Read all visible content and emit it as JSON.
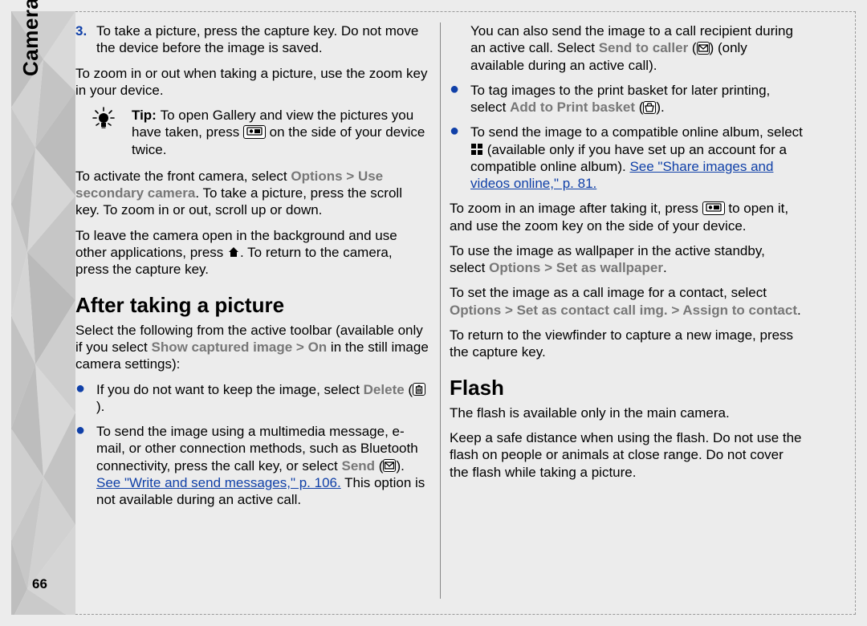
{
  "sidebar_label": "Camera",
  "page_number": "66",
  "left": {
    "num3": {
      "n": "3.",
      "text": "To take a picture, press the capture key. Do not move the device before the image is saved."
    },
    "p_zoom": "To zoom in or out when taking a picture, use the zoom key in your device.",
    "tip_prefix": "Tip: ",
    "tip_a": "To open Gallery and view the pictures you have taken, press ",
    "tip_b": " on the side of your device twice.",
    "front_a": "To activate the front camera, select ",
    "front_menu_a": "Options",
    "front_gt": " > ",
    "front_menu_b": "Use secondary camera",
    "front_b": ". To take a picture, press the scroll key. To zoom in or out, scroll up or down.",
    "bg_a": "To leave the camera open in the background and use other applications, press ",
    "bg_b": ". To return to the camera, press the capture key.",
    "h_after": "After taking a picture",
    "after_intro_a": "Select the following from the active toolbar (available only if you select ",
    "after_intro_menu": "Show captured image",
    "after_intro_gt": " > ",
    "after_intro_on": "On",
    "after_intro_b": " in the still image camera settings):",
    "bul1_a": "If you do not want to keep the image, select ",
    "bul1_menu": "Delete",
    "bul1_b": " (",
    "bul1_c": ").",
    "bul2_a": "To send the image using a multimedia message, e-mail, or other connection methods, such as Bluetooth connectivity, press the call key, or select ",
    "bul2_menu": "Send",
    "bul2_b": " (",
    "bul2_c": "). ",
    "bul2_link": "See \"Write and send messages,\" p. 106.",
    "bul2_d": " This option is not available during an active call."
  },
  "right": {
    "caller_a": "You can also send the image to a call recipient during an active call. Select ",
    "caller_menu": "Send to caller",
    "caller_b": " (",
    "caller_c": ") (only available during an active call).",
    "bul3_a": "To tag images to the print basket for later printing, select ",
    "bul3_menu": "Add to Print basket",
    "bul3_b": " (",
    "bul3_c": ").",
    "bul4_a": "To send the image to a compatible online album, select ",
    "bul4_b": " (available only if you have set up an account for a compatible online album). ",
    "bul4_link": "See \"Share images and videos online,\" p. 81.",
    "zoom_a": "To zoom in an image after taking it, press ",
    "zoom_b": " to open it, and use the zoom key on the side of your device.",
    "wall_a": "To use the image as wallpaper in the active standby, select ",
    "wall_menu_a": "Options",
    "wall_gt": " > ",
    "wall_menu_b": "Set as wallpaper",
    "wall_c": ".",
    "contact_a": "To set the image as a call image for a contact, select ",
    "contact_menu_a": "Options",
    "contact_gt1": " > ",
    "contact_menu_b": "Set as contact call img.",
    "contact_gt2": " > ",
    "contact_menu_c": "Assign to contact",
    "contact_b": ".",
    "return": "To return to the viewfinder to capture a new image, press the capture key.",
    "h_flash": "Flash",
    "flash_p1": "The flash is available only in the main camera.",
    "flash_p2": "Keep a safe distance when using the flash. Do not use the flash on people or animals at close range. Do not cover the flash while taking a picture."
  }
}
